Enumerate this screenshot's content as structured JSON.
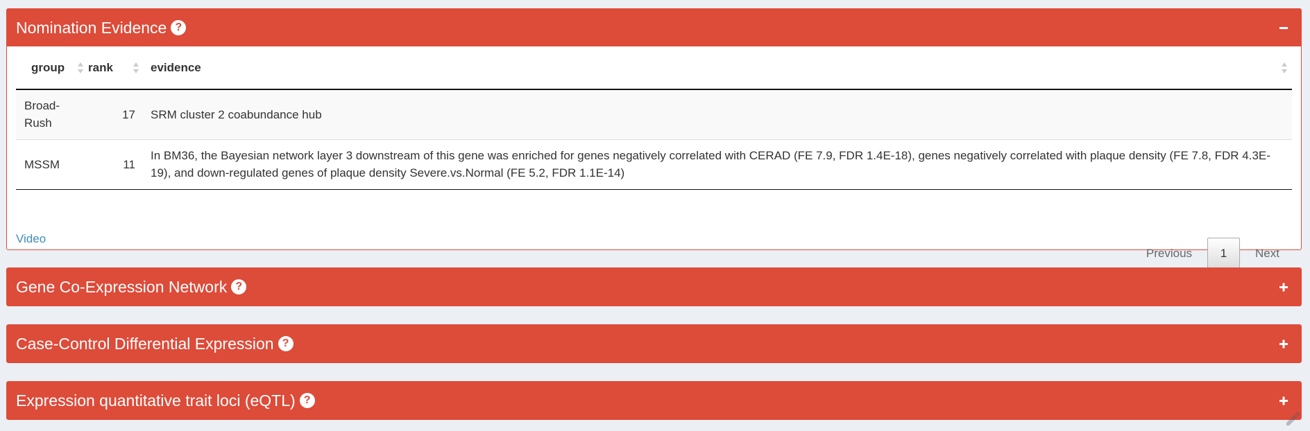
{
  "panels": [
    {
      "title": "Nomination Evidence",
      "expanded": true,
      "toggle": "minus-icon"
    },
    {
      "title": "Gene Co-Expression Network",
      "expanded": false,
      "toggle": "plus-icon"
    },
    {
      "title": "Case-Control Differential Expression",
      "expanded": false,
      "toggle": "plus-icon"
    },
    {
      "title": "Expression quantitative trait loci (eQTL)",
      "expanded": false,
      "toggle": "plus-icon"
    }
  ],
  "help_glyph": "?",
  "table": {
    "columns": [
      "group",
      "rank",
      "evidence"
    ],
    "rows": [
      {
        "group": "Broad-Rush",
        "rank": "17",
        "evidence": "SRM cluster 2 coabundance hub"
      },
      {
        "group": "MSSM",
        "rank": "11",
        "evidence": "In BM36, the Bayesian network layer 3 downstream of this gene was enriched for genes negatively correlated with CERAD (FE 7.9, FDR 1.4E-18), genes negatively correlated with plaque density (FE 7.8, FDR 4.3E-19), and down-regulated genes of plaque density Severe.vs.Normal (FE 5.2, FDR 1.1E-14)"
      }
    ]
  },
  "pagination": {
    "previous": "Previous",
    "current": "1",
    "next": "Next"
  },
  "video_link": "Video",
  "colors": {
    "header_bg": "#dd4b39",
    "page_bg": "#ecf0f5",
    "link": "#3c8dbc"
  }
}
